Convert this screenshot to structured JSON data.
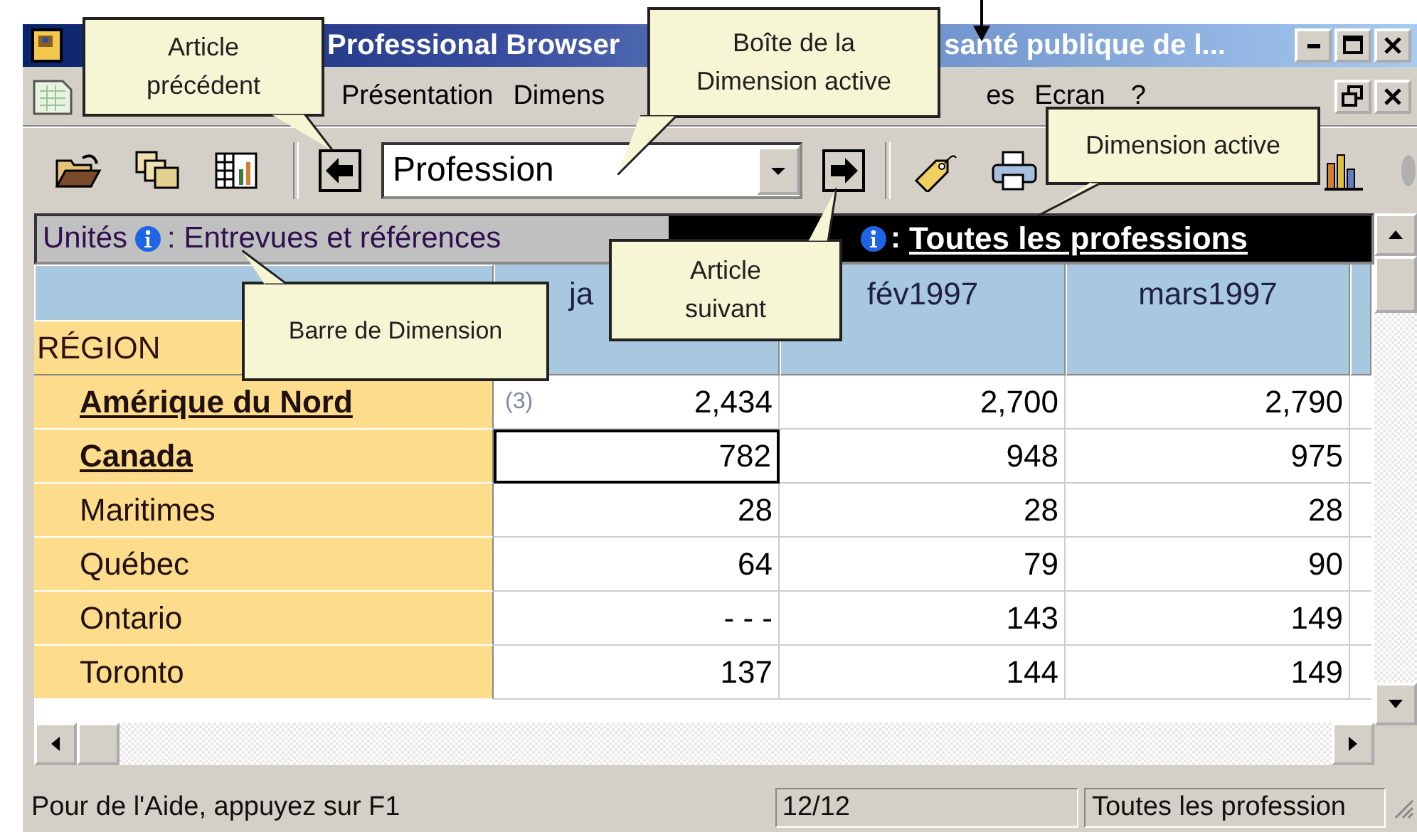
{
  "window": {
    "title_left": "Professional Browser",
    "title_right": "santé publique de l..."
  },
  "menu": [
    {
      "label": "Présentation"
    },
    {
      "label": "Dimens"
    },
    {
      "label": "es"
    },
    {
      "label": "Ecran"
    },
    {
      "label": "?"
    }
  ],
  "toolbar": {
    "dimension_box": {
      "value": "Profession"
    }
  },
  "dimension_bar": {
    "units_label": "Unités",
    "units_value": ": Entrevues et références",
    "active_separator": ":",
    "active_value": "Toutes les professions"
  },
  "table": {
    "row_header": "RÉGION",
    "columns": [
      "ja",
      "fév1997",
      "mars1997"
    ],
    "rows": [
      {
        "label": "Amérique du Nord",
        "emphasized": true,
        "note": "(3)",
        "cells": [
          {
            "text": "2,434",
            "selected": false
          },
          {
            "text": "2,700",
            "selected": false
          },
          {
            "text": "2,790",
            "selected": false
          }
        ]
      },
      {
        "label": "Canada",
        "emphasized": true,
        "cells": [
          {
            "text": "782",
            "selected": true
          },
          {
            "text": "948",
            "selected": false
          },
          {
            "text": "975",
            "selected": false
          }
        ]
      },
      {
        "label": "Maritimes",
        "emphasized": false,
        "cells": [
          {
            "text": "28",
            "selected": false
          },
          {
            "text": "28",
            "selected": false
          },
          {
            "text": "28",
            "selected": false
          }
        ]
      },
      {
        "label": "Québec",
        "emphasized": false,
        "cells": [
          {
            "text": "64",
            "selected": false
          },
          {
            "text": "79",
            "selected": false
          },
          {
            "text": "90",
            "selected": false
          }
        ]
      },
      {
        "label": "Ontario",
        "emphasized": false,
        "cells": [
          {
            "text": "- - -",
            "selected": false
          },
          {
            "text": "143",
            "selected": false
          },
          {
            "text": "149",
            "selected": false
          }
        ]
      },
      {
        "label": "Toronto",
        "emphasized": false,
        "cells": [
          {
            "text": "137",
            "selected": false
          },
          {
            "text": "144",
            "selected": false
          },
          {
            "text": "149",
            "selected": false
          }
        ]
      }
    ]
  },
  "status_bar": [
    "Pour de l'Aide, appuyez sur F1",
    "12/12",
    "Toutes les profession"
  ],
  "callouts": [
    {
      "text": "Article précédent"
    },
    {
      "text": "Boîte de la Dimension active"
    },
    {
      "text": "Dimension active"
    },
    {
      "text": "Article suivant"
    },
    {
      "text": "Barre de Dimension"
    }
  ]
}
